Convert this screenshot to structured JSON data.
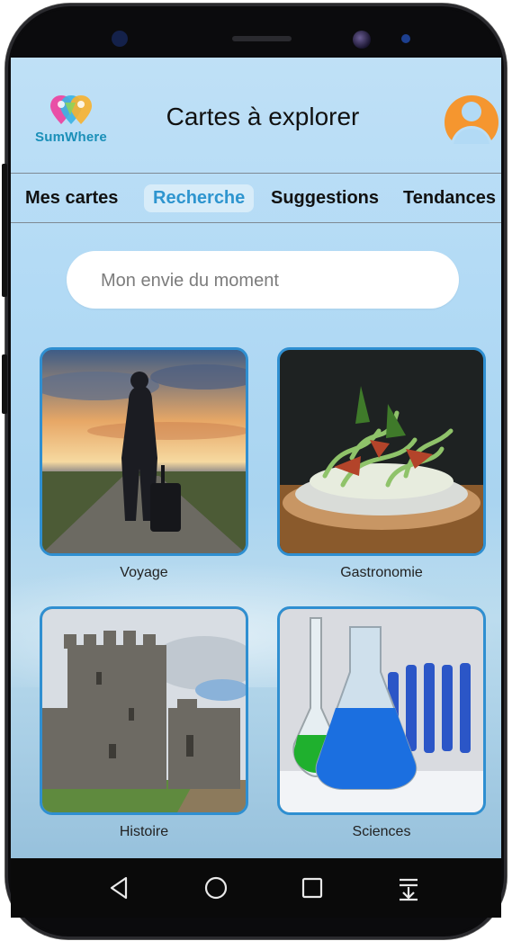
{
  "header": {
    "logo_text": "SumWhere",
    "title": "Cartes à explorer"
  },
  "tabs": [
    {
      "label": "Mes cartes",
      "active": false
    },
    {
      "label": "Recherche",
      "active": true
    },
    {
      "label": "Suggestions",
      "active": false
    },
    {
      "label": "Tendances",
      "active": false
    }
  ],
  "search": {
    "placeholder": "Mon envie du moment",
    "value": ""
  },
  "categories": [
    {
      "label": "Voyage",
      "icon": "travel-photo"
    },
    {
      "label": "Gastronomie",
      "icon": "food-photo"
    },
    {
      "label": "Histoire",
      "icon": "castle-photo"
    },
    {
      "label": "Sciences",
      "icon": "lab-flask-photo"
    }
  ],
  "navbar": {
    "icons": [
      "back-icon",
      "home-icon",
      "recents-icon",
      "notification-pull-icon"
    ]
  },
  "colors": {
    "accent": "#2e95cf",
    "card_border": "#2f8fd1",
    "avatar": "#f5962f",
    "background_sky": "#b2daf5"
  }
}
